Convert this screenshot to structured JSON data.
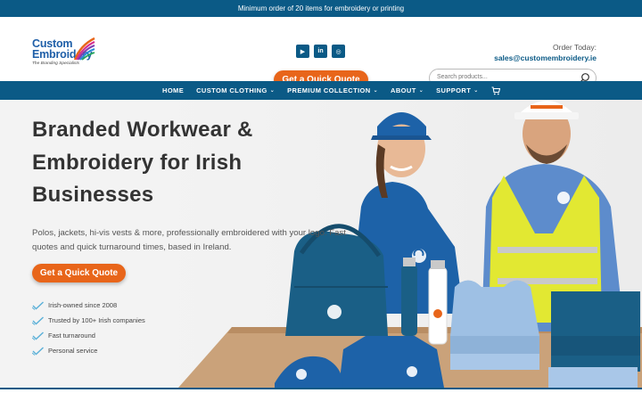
{
  "topbar": {
    "text": "Minimum order of 20 items for embroidery or printing"
  },
  "logo": {
    "line1": "Custom",
    "line2": "Embroidery",
    "tagline": "The Branding Specialists"
  },
  "social": [
    {
      "icon": "youtube-icon",
      "glyph": "▶"
    },
    {
      "icon": "linkedin-icon",
      "glyph": "in"
    },
    {
      "icon": "instagram-icon",
      "glyph": "◎"
    }
  ],
  "header": {
    "quote_button": "Get a Quick Quote",
    "order_today": "Order Today:",
    "email": "sales@customembroidery.ie",
    "search_placeholder": "Search products..."
  },
  "nav": {
    "items": [
      {
        "label": "HOME",
        "dropdown": false
      },
      {
        "label": "CUSTOM CLOTHING",
        "dropdown": true
      },
      {
        "label": "PREMIUM COLLECTION",
        "dropdown": true
      },
      {
        "label": "ABOUT",
        "dropdown": true
      },
      {
        "label": "SUPPORT",
        "dropdown": true
      }
    ]
  },
  "hero": {
    "title_line1": "Branded Workwear &",
    "title_line2": "Embroidery for Irish",
    "title_line3": "Businesses",
    "subtitle": "Polos, jackets, hi-vis vests & more, professionally embroidered with your logo. Fast quotes and quick turnaround times, based in Ireland.",
    "quote_button": "Get a Quick Quote",
    "features": [
      "Irish-owned since 2008",
      "Trusted by 100+ Irish companies",
      "Fast turnaround",
      "Personal service"
    ]
  },
  "colors": {
    "brand_blue": "#0b5a86",
    "accent_orange": "#e8651a",
    "hivis_yellow": "#e2e832"
  }
}
